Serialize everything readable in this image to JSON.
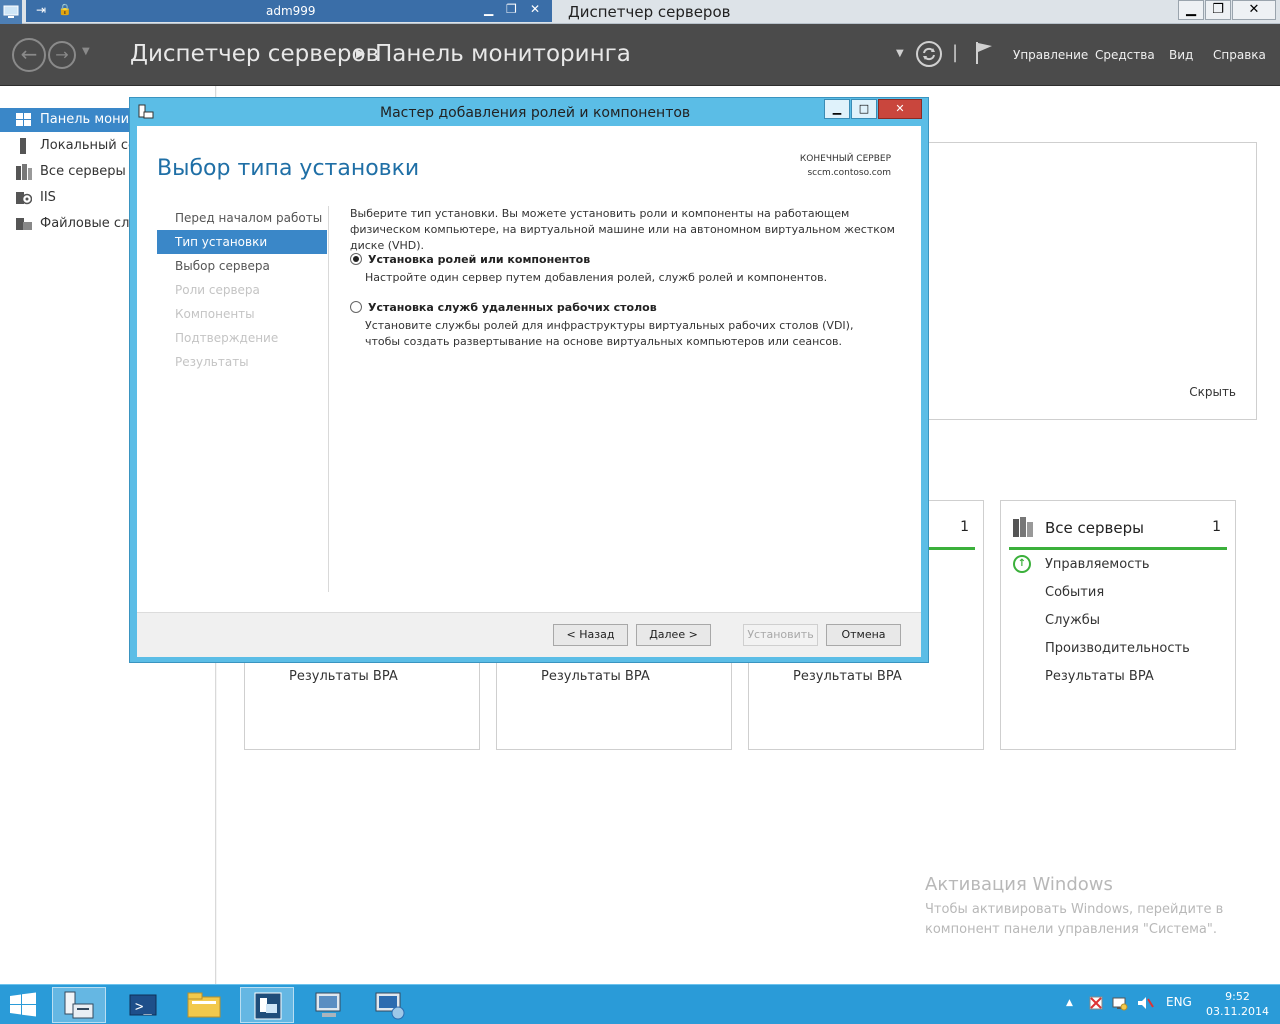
{
  "remote": {
    "tab_name": "adm999",
    "window_title": "Диспетчер серверов"
  },
  "header": {
    "breadcrumb_app": "Диспетчер серверов",
    "breadcrumb_page": "Панель мониторинга",
    "menu": [
      "Управление",
      "Средства",
      "Вид",
      "Справка"
    ]
  },
  "sidebar": {
    "items": [
      {
        "label": "Панель монит",
        "icon": "dashboard-icon"
      },
      {
        "label": "Локальный се",
        "icon": "local-server-icon"
      },
      {
        "label": "Все серверы",
        "icon": "all-servers-icon"
      },
      {
        "label": "IIS",
        "icon": "iis-icon"
      },
      {
        "label": "Файловые слу",
        "icon": "file-services-icon"
      }
    ]
  },
  "dashboard": {
    "hide_link": "Скрыть",
    "tile_count_partial": "1",
    "tiles_bpa": "Результаты BPA",
    "all_servers": {
      "title": "Все серверы",
      "count": "1",
      "rows": [
        "Управляемость",
        "События",
        "Службы",
        "Производительность",
        "Результаты BPA"
      ]
    },
    "activation_title": "Активация Windows",
    "activation_text": "Чтобы активировать Windows, перейдите в компонент панели управления \"Система\"."
  },
  "wizard": {
    "title": "Мастер добавления ролей и компонентов",
    "heading": "Выбор типа установки",
    "dest_label": "КОНЕЧНЫЙ СЕРВЕР",
    "dest_server": "sccm.contoso.com",
    "steps": [
      {
        "label": "Перед началом работы",
        "state": "done"
      },
      {
        "label": "Тип установки",
        "state": "current"
      },
      {
        "label": "Выбор сервера",
        "state": "done"
      },
      {
        "label": "Роли сервера",
        "state": "disabled"
      },
      {
        "label": "Компоненты",
        "state": "disabled"
      },
      {
        "label": "Подтверждение",
        "state": "disabled"
      },
      {
        "label": "Результаты",
        "state": "disabled"
      }
    ],
    "intro": "Выберите тип установки. Вы можете установить роли и компоненты на работающем физическом компьютере, на виртуальной машине или на автономном виртуальном жестком диске (VHD).",
    "option1_title": "Установка ролей или компонентов",
    "option1_desc": "Настройте один сервер путем добавления ролей, служб ролей и компонентов.",
    "option2_title": "Установка служб удаленных рабочих столов",
    "option2_desc": "Установите службы ролей для инфраструктуры виртуальных рабочих столов (VDI), чтобы создать развертывание на основе виртуальных компьютеров или сеансов.",
    "selected_option": 1,
    "buttons": {
      "back": "< Назад",
      "next": "Далее >",
      "install": "Установить",
      "cancel": "Отмена"
    }
  },
  "taskbar": {
    "lang": "ENG",
    "time": "9:52",
    "date": "03.11.2014"
  },
  "colors": {
    "accent": "#3a87c8",
    "wizard_frame": "#5bbde6",
    "taskbar": "#2a9bd8",
    "header_bg": "#4b4b4b",
    "status_ok": "#3bb03b"
  }
}
